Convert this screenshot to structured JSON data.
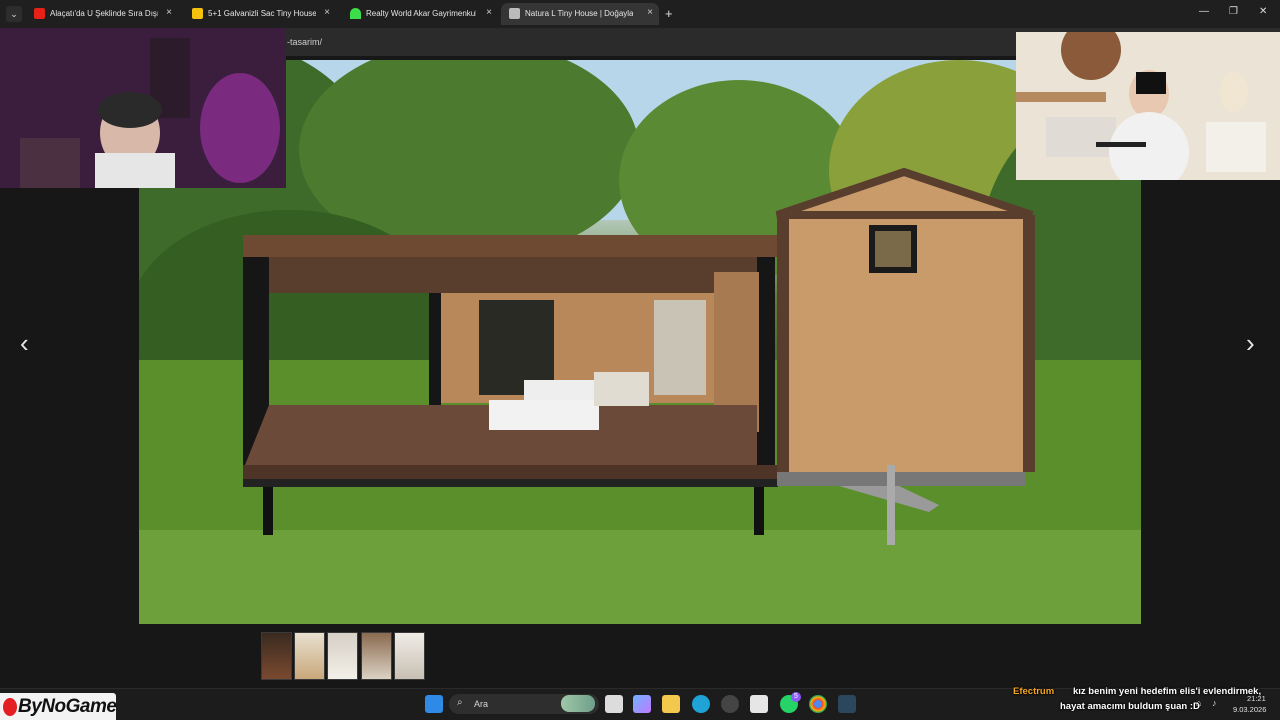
{
  "browser": {
    "tabs": [
      {
        "title": "Alaçatı'da U Şeklinde Sıra Dışı E",
        "favicon_color": "#e62117"
      },
      {
        "title": "5+1 Galvanizli Sac Tiny House",
        "favicon_color": "#f4c20d"
      },
      {
        "title": "Realty World Akar Gayrimenkul",
        "favicon_color": "#3ddc4a"
      },
      {
        "title": "Natura L Tiny House | Doğayla",
        "favicon_color": "#bbbbbb",
        "active": true
      }
    ],
    "new_tab_label": "+",
    "close_glyph": "×",
    "url": "-tasarim/"
  },
  "lightbox": {
    "prev_glyph": "‹",
    "next_glyph": "›",
    "thumbnail_count": 5
  },
  "overlay": {
    "brand": "ByNoGame",
    "chat_user": "Efectrum",
    "chat_line1": "kız benim yeni hedefim elis'i evlendirmek,",
    "chat_line2": "hayat amacımı buldum şuan :D"
  },
  "taskbar": {
    "search_placeholder": "Ara",
    "time": "21:21",
    "date": "9.03.2026",
    "whatsapp_badge": "5"
  },
  "colors": {
    "accent_chat_user": "#f5a623",
    "wood": "#c79a66",
    "deck": "#6b4a3a"
  }
}
